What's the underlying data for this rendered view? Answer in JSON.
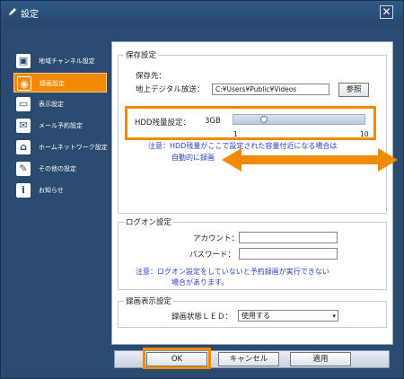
{
  "window": {
    "title": "設定"
  },
  "sidebar": {
    "items": [
      {
        "label": "地域チャンネル設定",
        "icon": "tv-icon"
      },
      {
        "label": "録画設定",
        "icon": "record-icon"
      },
      {
        "label": "表示設定",
        "icon": "display-icon"
      },
      {
        "label": "メール予約設定",
        "icon": "mail-icon"
      },
      {
        "label": "ホームネットワーク設定",
        "icon": "network-icon"
      },
      {
        "label": "その他の設定",
        "icon": "wrench-icon"
      },
      {
        "label": "お知らせ",
        "icon": "info-icon"
      }
    ],
    "active_index": 1
  },
  "storage": {
    "legend": "保存設定",
    "save_to_label": "保存先：",
    "terrestrial_label": "地上デジタル放送：",
    "path_value": "C:¥Users¥Public¥Videos",
    "browse_label": "参照",
    "hdd_label": "HDD残量設定：",
    "hdd_value": "3GB",
    "slider_min": "1",
    "slider_max": "10",
    "slider_level": 3,
    "note_line1": "注意：HDD残量がここで設定された容量付近になる場合は",
    "note_line2": "自動的に録画"
  },
  "logon": {
    "legend": "ログオン設定",
    "account_label": "アカウント：",
    "account_value": "",
    "password_label": "パスワード：",
    "password_value": "",
    "note_line1": "注意：ログオン設定をしていないと予約録画が実行できない",
    "note_line2": "場合があります。"
  },
  "record_display": {
    "legend": "録画表示設定",
    "led_label": "録画状態ＬＥＤ：",
    "led_value": "使用する"
  },
  "buttons": {
    "ok": "OK",
    "cancel": "キャンセル",
    "apply": "適用"
  },
  "colors": {
    "highlight": "#f28a00",
    "note_text": "#2a3ec4",
    "window_bg": "#2a4a6f"
  }
}
